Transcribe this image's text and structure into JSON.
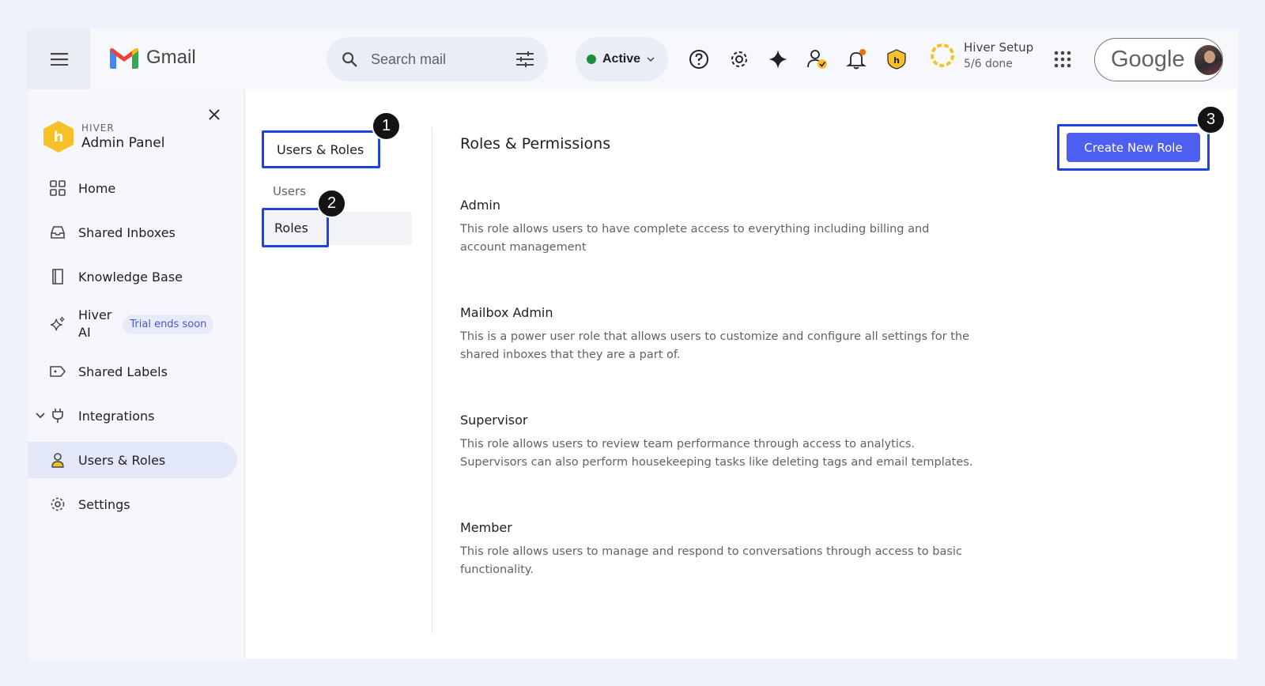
{
  "header": {
    "app_name": "Gmail",
    "search_placeholder": "Search mail",
    "status": "Active",
    "setup_title": "Hiver Setup",
    "setup_progress": "5/6 done",
    "account_brand": "Google",
    "icons": [
      "menu-icon",
      "gmail-logo-icon",
      "search-icon",
      "filter-options-icon",
      "chevron-down-icon",
      "help-icon",
      "gear-icon",
      "sparkle-icon",
      "user-check-icon",
      "bell-icon",
      "hiver-shield-icon",
      "apps-grid-icon"
    ],
    "colors": {
      "status_active": "#1e8e3e",
      "notification_dot": "#e8710a",
      "setup_ring": "#f6c026"
    }
  },
  "sidebar": {
    "kicker": "HIVER",
    "title": "Admin Panel",
    "items": [
      {
        "label": "Home",
        "icon": "grid-icon"
      },
      {
        "label": "Shared Inboxes",
        "icon": "inbox-icon"
      },
      {
        "label": "Knowledge Base",
        "icon": "book-icon"
      },
      {
        "label": "Hiver\nAI",
        "icon": "sparkles-icon",
        "badge": "Trial ends soon"
      },
      {
        "label": "Shared Labels",
        "icon": "label-share-icon"
      },
      {
        "label": "Integrations",
        "icon": "plug-icon"
      },
      {
        "label": "Users & Roles",
        "icon": "person-icon",
        "active": true
      },
      {
        "label": "Settings",
        "icon": "gear-icon"
      }
    ]
  },
  "subnav": {
    "heading": "Users & Roles",
    "items": [
      {
        "label": "Users"
      },
      {
        "label": "Roles",
        "active": true
      }
    ]
  },
  "main": {
    "title": "Roles & Permissions",
    "create_button": "Create New Role",
    "roles": [
      {
        "name": "Admin",
        "description": "This role allows users to have complete access to everything including billing and account management"
      },
      {
        "name": "Mailbox Admin",
        "description": "This is a power user role that allows users to customize and configure all settings for the shared inboxes that they are a part of."
      },
      {
        "name": "Supervisor",
        "description": "This role allows users to review team performance through access to analytics.\nSupervisors can also perform housekeeping tasks like deleting tags and email templates."
      },
      {
        "name": "Member",
        "description": "This role allows users to manage and respond to conversations through access to basic functionality."
      }
    ]
  },
  "markers": [
    "1",
    "2",
    "3"
  ],
  "accent": {
    "highlight_border": "#1f43e0",
    "primary_button": "#4d5ff1"
  }
}
